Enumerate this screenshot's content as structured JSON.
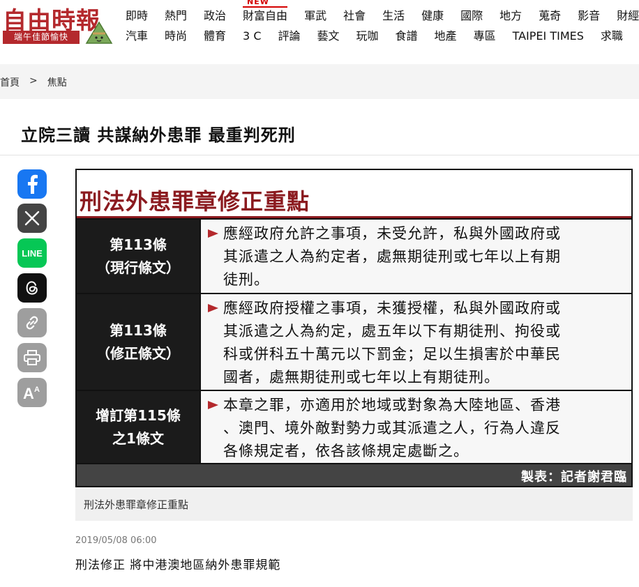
{
  "header": {
    "logo_title": "自由時報",
    "logo_badge": "端午佳節愉快",
    "nav_row1": [
      {
        "label": "即時"
      },
      {
        "label": "熱門"
      },
      {
        "label": "政治"
      },
      {
        "label": "財富自由",
        "badge": "NEW"
      },
      {
        "label": "軍武"
      },
      {
        "label": "社會"
      },
      {
        "label": "生活"
      },
      {
        "label": "健康"
      },
      {
        "label": "國際"
      },
      {
        "label": "地方"
      },
      {
        "label": "蒐奇"
      },
      {
        "label": "影音"
      },
      {
        "label": "財經"
      }
    ],
    "nav_row2": [
      {
        "label": "汽車"
      },
      {
        "label": "時尚"
      },
      {
        "label": "體育"
      },
      {
        "label": "3 C"
      },
      {
        "label": "評論"
      },
      {
        "label": "藝文"
      },
      {
        "label": "玩咖"
      },
      {
        "label": "食譜"
      },
      {
        "label": "地產"
      },
      {
        "label": "專區"
      },
      {
        "label": "TAIPEI TIMES"
      },
      {
        "label": "求職"
      }
    ]
  },
  "breadcrumb": {
    "home": "首頁",
    "separator": ">",
    "section": "焦點"
  },
  "article": {
    "title": "立院三讀 共謀納外患罪 最重判死刑",
    "timestamp": "2019/05/08 06:00",
    "lead": "刑法修正 將中港澳地區納外患罪規範"
  },
  "share": [
    {
      "name": "facebook",
      "color": "#1877f2"
    },
    {
      "name": "x",
      "color": "#444444"
    },
    {
      "name": "line",
      "color": "#06c755"
    },
    {
      "name": "threads",
      "color": "#111111"
    },
    {
      "name": "copy-link",
      "color": "#9e9e9e"
    },
    {
      "name": "print",
      "color": "#9e9e9e"
    },
    {
      "name": "font-size",
      "color": "#9e9e9e",
      "glyph": "A",
      "glyph_small": "A"
    }
  ],
  "figure": {
    "title": "刑法外患罪章修正重點",
    "rows": [
      {
        "label_line1": "第113條",
        "label_line2": "（現行條文）",
        "body_lines": [
          "應經政府允許之事項，未受允許，私與外國政府或",
          "其派遣之人為約定者，處無期徒刑或七年以上有期",
          "徒刑。"
        ]
      },
      {
        "label_line1": "第113條",
        "label_line2": "（修正條文）",
        "body_lines": [
          "應經政府授權之事項，未獲授權，私與外國政府或",
          "其派遣之人為約定，處五年以下有期徒刑、拘役或",
          "科或併科五十萬元以下罰金；足以生損害於中華民",
          "國者，處無期徒刑或七年以上有期徒刑。"
        ]
      },
      {
        "label_line1": "增訂第115條",
        "label_line2": "之1條文",
        "body_lines": [
          "本章之罪，亦適用於地域或對象為大陸地區、香港",
          "、澳門、境外敵對勢力或其派遣之人，行為人違反",
          "各條規定者，依各該條規定處斷之。"
        ]
      }
    ],
    "credit": "製表：記者謝君臨",
    "caption": "刑法外患罪章修正重點",
    "accent": "#8b1a1f"
  }
}
